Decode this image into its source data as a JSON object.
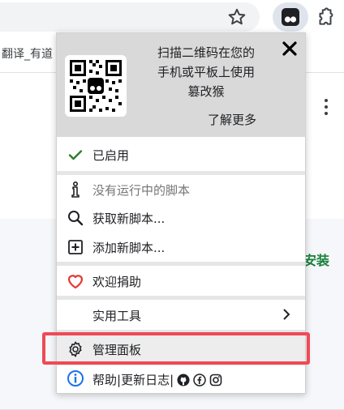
{
  "bookmarks": {
    "partial_item": "翻译_有道"
  },
  "page": {
    "install_link": "安装"
  },
  "popup": {
    "promo": {
      "line1": "扫描二维码在您的",
      "line2": "手机或平板上使用",
      "line3": "篡改猴",
      "learn_more": "了解更多"
    },
    "status": {
      "label": "已启用"
    },
    "scripts": {
      "no_running": "没有运行中的脚本",
      "get_new": "获取新脚本...",
      "add_new": "添加新脚本..."
    },
    "donate": "欢迎捐助",
    "utilities": "实用工具",
    "dashboard": "管理面板",
    "footer": {
      "help": "帮助",
      "sep1": " | ",
      "changelog": "更新日志",
      "sep2": " |"
    }
  },
  "colors": {
    "enabled_check": "#2e7d32",
    "heart": "#e53935",
    "info": "#1a73e8",
    "highlight_border": "#f04a55",
    "install_link": "#188038"
  }
}
